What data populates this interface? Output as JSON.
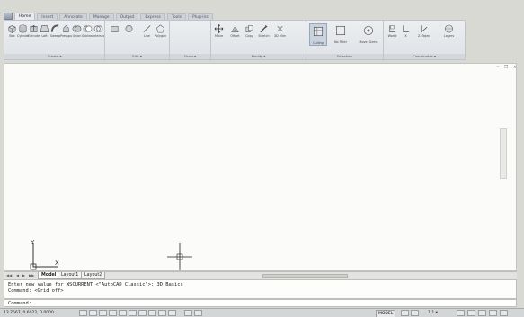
{
  "tabs": [
    {
      "label": "Home",
      "active": true
    },
    {
      "label": "Insert",
      "active": false
    },
    {
      "label": "Annotate",
      "active": false
    },
    {
      "label": "Manage",
      "active": false
    },
    {
      "label": "Output",
      "active": false
    },
    {
      "label": "Express",
      "active": false
    },
    {
      "label": "Tools",
      "active": false
    },
    {
      "label": "Plug-ins",
      "active": false
    }
  ],
  "ribbon": {
    "groups": [
      {
        "label": "Create ▾",
        "tools": [
          "Box",
          "Cylinder",
          "Extrude",
          "Loft",
          "Sweep",
          "Presspull",
          "Union",
          "Subtract",
          "Intersect"
        ]
      },
      {
        "label": "Edit ▾",
        "tools": [
          "Line",
          "Polygon"
        ]
      },
      {
        "label": "Draw ▾",
        "tools": []
      },
      {
        "label": "Modify ▾",
        "tools": [
          "Move",
          "Offset",
          "Copy",
          "Stretch",
          "3D Mirror"
        ]
      },
      {
        "label": "Selection",
        "tools": [
          "Culling",
          "No Filter",
          "Move Gizmo"
        ]
      },
      {
        "label": "Coordinates ▾",
        "tools": [
          "World",
          "X",
          "Z-Object",
          "Layers"
        ]
      }
    ]
  },
  "window_controls": "– ❐ ×",
  "layout_tabs": [
    {
      "label": "Model",
      "active": true
    },
    {
      "label": "Layout1",
      "active": false
    },
    {
      "label": "Layout2",
      "active": false
    }
  ],
  "command_history": [
    "Enter new value for WSCURRENT <\"AutoCAD Classic\">: 3D Basics",
    "Command:  <Grid off>"
  ],
  "command_prompt": "Command:",
  "status": {
    "coordinates": "13.7567, 0.6022, 0.0000",
    "model_label": "MODEL",
    "annotation_scale": "1:1 ▾"
  },
  "ucs": {
    "x_label": "X",
    "y_label": "Y"
  }
}
